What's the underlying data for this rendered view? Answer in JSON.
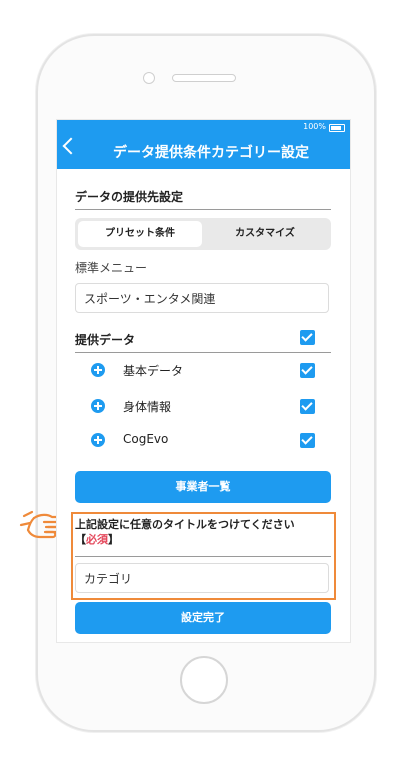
{
  "status": {
    "battery": "100%"
  },
  "header": {
    "title": "データ提供条件カテゴリー設定"
  },
  "section": {
    "title": "データの提供先設定"
  },
  "segments": {
    "preset": "プリセット条件",
    "custom": "カスタマイズ"
  },
  "standard_menu": {
    "label": "標準メニュー",
    "value": "スポーツ・エンタメ関連"
  },
  "provided_data": {
    "label": "提供データ",
    "items": [
      {
        "label": "基本データ"
      },
      {
        "label": "身体情報"
      },
      {
        "label": "CogEvo"
      }
    ]
  },
  "buttons": {
    "vendors": "事業者一覧",
    "complete": "設定完了"
  },
  "title_input": {
    "prompt": "上記設定に任意のタイトルをつけてください",
    "required_open": "【",
    "required": "必須",
    "required_close": "】",
    "value": "カテゴリ"
  },
  "colors": {
    "accent": "#1e9bf0",
    "highlight": "#ef8a3a",
    "required": "#e4475b"
  }
}
